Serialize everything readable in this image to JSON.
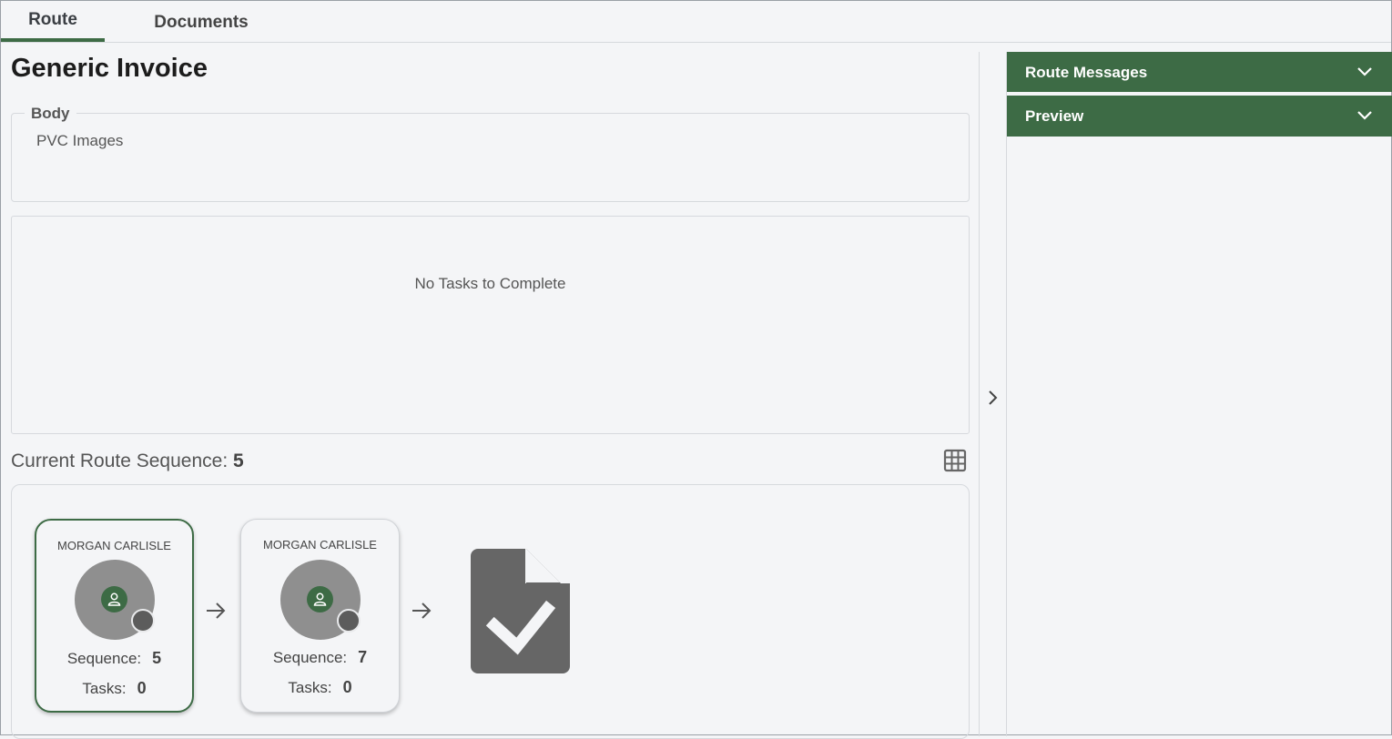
{
  "tabs": [
    {
      "label": "Route",
      "active": true
    },
    {
      "label": "Documents",
      "active": false
    }
  ],
  "page": {
    "title": "Generic Invoice",
    "body_label": "Body",
    "body_value": "PVC Images"
  },
  "tasks": {
    "empty_message": "No Tasks to Complete"
  },
  "route_sequence": {
    "label": "Current Route Sequence:",
    "current": "5",
    "grid_icon": "grid-view-icon",
    "steps": [
      {
        "name": "MORGAN CARLISLE",
        "sequence_label": "Sequence:",
        "sequence": "5",
        "tasks_label": "Tasks:",
        "tasks": "0",
        "active": true
      },
      {
        "name": "MORGAN CARLISLE",
        "sequence_label": "Sequence:",
        "sequence": "7",
        "tasks_label": "Tasks:",
        "tasks": "0",
        "active": false
      }
    ],
    "end_icon": "document-check-icon"
  },
  "right_panel": {
    "sections": [
      {
        "label": "Route Messages"
      },
      {
        "label": "Preview"
      }
    ]
  },
  "colors": {
    "accent": "#3d6b45",
    "background": "#f4f5f7",
    "avatar": "#8f8f8f",
    "doc_icon": "#666666"
  }
}
